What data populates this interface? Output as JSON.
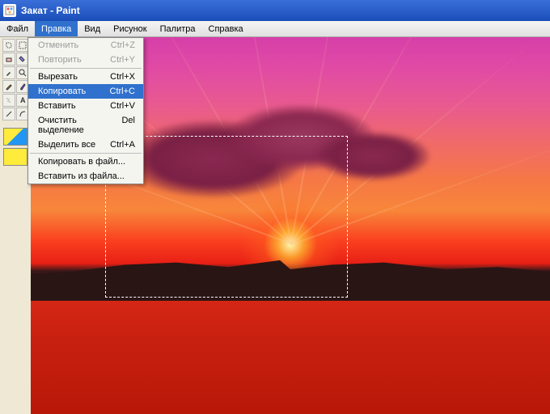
{
  "titlebar": {
    "title": "Закат - Paint"
  },
  "menubar": {
    "items": [
      {
        "label": "Файл"
      },
      {
        "label": "Правка"
      },
      {
        "label": "Вид"
      },
      {
        "label": "Рисунок"
      },
      {
        "label": "Палитра"
      },
      {
        "label": "Справка"
      }
    ]
  },
  "dropdown": {
    "items": [
      {
        "label": "Отменить",
        "shortcut": "Ctrl+Z",
        "disabled": true
      },
      {
        "label": "Повторить",
        "shortcut": "Ctrl+Y",
        "disabled": true
      },
      {
        "sep": true
      },
      {
        "label": "Вырезать",
        "shortcut": "Ctrl+X"
      },
      {
        "label": "Копировать",
        "shortcut": "Ctrl+C",
        "highlighted": true
      },
      {
        "label": "Вставить",
        "shortcut": "Ctrl+V"
      },
      {
        "label": "Очистить выделение",
        "shortcut": "Del"
      },
      {
        "label": "Выделить все",
        "shortcut": "Ctrl+A"
      },
      {
        "sep": true
      },
      {
        "label": "Копировать в файл..."
      },
      {
        "label": "Вставить из файла..."
      }
    ]
  }
}
